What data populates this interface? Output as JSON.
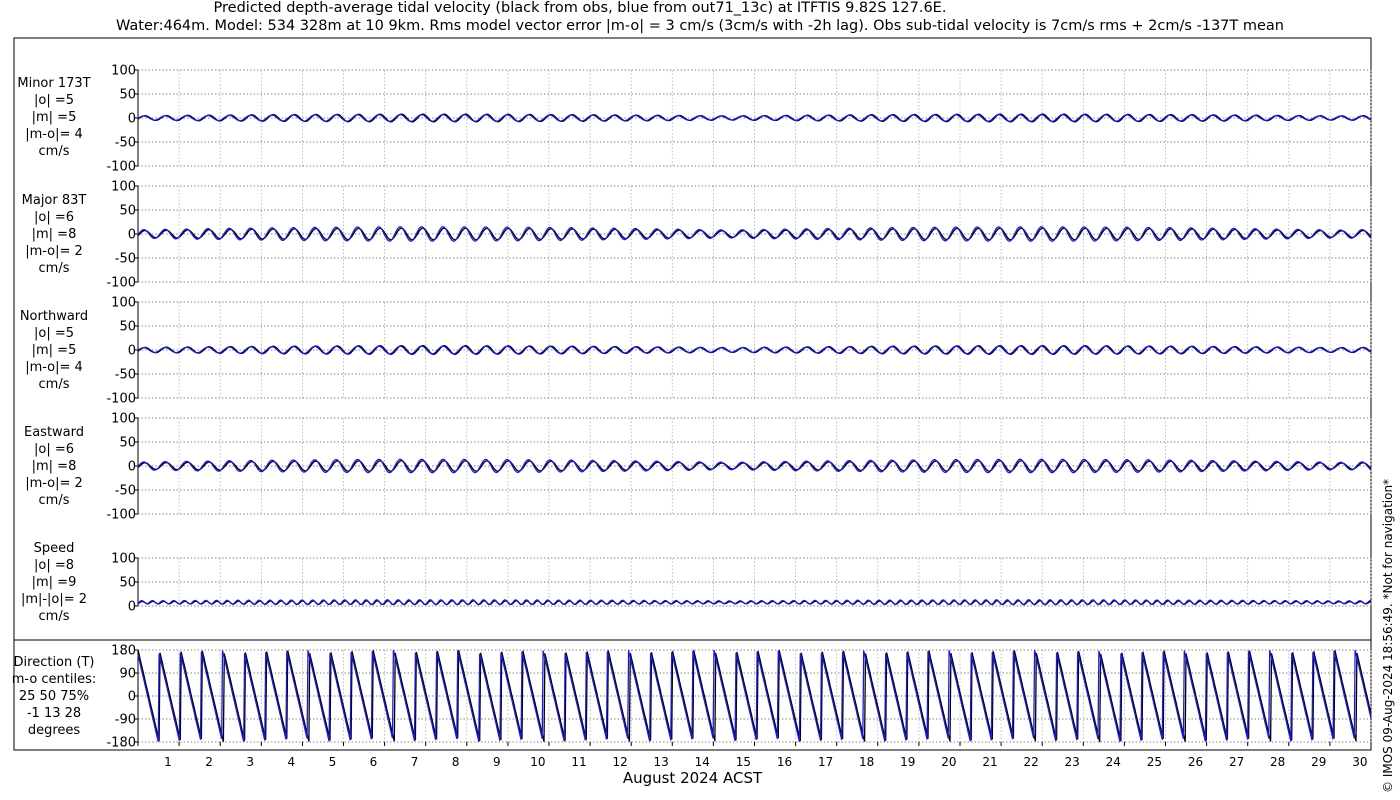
{
  "title_line1": "Predicted depth-average tidal velocity (black from obs, blue from out71_13c) at ITFTIS 9.82S 127.6E.",
  "title_line2": "Water:464m. Model: 534 328m at 10 9km. Rms model vector error |m-o| = 3 cm/s (3cm/s with -2h lag). Obs sub-tidal velocity is 7cm/s rms + 2cm/s -137T mean",
  "credit": "© IMOS 09-Aug-2024 18:56:49. *Not for navigation*",
  "x_axis_title": "August 2024 ACST",
  "colors": {
    "obs": "#000000",
    "model": "#1a1adf",
    "grid": "#b0b0b0"
  },
  "chart_data": [
    {
      "type": "line",
      "panel": "minor",
      "label_lines": [
        "Minor 173T",
        "|o| =5",
        "|m| =5",
        "|m-o|= 4",
        "cm/s"
      ],
      "ylim": [
        -100,
        100
      ],
      "yticks": [
        100,
        50,
        0,
        -50,
        -100
      ],
      "xlim": [
        1,
        31
      ],
      "xtick_labels": [
        "1",
        "2",
        "3",
        "4",
        "5",
        "6",
        "7",
        "8",
        "9",
        "10",
        "11",
        "12",
        "13",
        "14",
        "15",
        "16",
        "17",
        "18",
        "19",
        "20",
        "21",
        "22",
        "23",
        "24",
        "25",
        "26",
        "27",
        "28",
        "29",
        "30"
      ],
      "series": [
        {
          "name": "obs",
          "amplitude": 8,
          "mean": 0,
          "period_days": 0.52
        },
        {
          "name": "model",
          "amplitude": 7,
          "mean": 0,
          "period_days": 0.52
        }
      ]
    },
    {
      "type": "line",
      "panel": "major",
      "label_lines": [
        "Major 83T",
        "|o| =6",
        "|m| =8",
        "|m-o|= 2",
        "cm/s"
      ],
      "ylim": [
        -100,
        100
      ],
      "yticks": [
        100,
        50,
        0,
        -50,
        -100
      ],
      "xlim": [
        1,
        31
      ],
      "series": [
        {
          "name": "obs",
          "amplitude": 12,
          "mean": 0,
          "period_days": 0.52
        },
        {
          "name": "model",
          "amplitude": 15,
          "mean": 0,
          "period_days": 0.52
        }
      ]
    },
    {
      "type": "line",
      "panel": "northward",
      "label_lines": [
        "Northward",
        "|o| =5",
        "|m| =5",
        "|m-o|= 4",
        "cm/s"
      ],
      "ylim": [
        -100,
        100
      ],
      "yticks": [
        100,
        50,
        0,
        -50,
        -100
      ],
      "xlim": [
        1,
        31
      ],
      "series": [
        {
          "name": "obs",
          "amplitude": 9,
          "mean": 0,
          "period_days": 0.52
        },
        {
          "name": "model",
          "amplitude": 8,
          "mean": 0,
          "period_days": 0.52
        }
      ]
    },
    {
      "type": "line",
      "panel": "eastward",
      "label_lines": [
        "Eastward",
        "|o| =6",
        "|m| =8",
        "|m-o|= 2",
        "cm/s"
      ],
      "ylim": [
        -100,
        100
      ],
      "yticks": [
        100,
        50,
        0,
        -50,
        -100
      ],
      "xlim": [
        1,
        31
      ],
      "series": [
        {
          "name": "obs",
          "amplitude": 11,
          "mean": 0,
          "period_days": 0.52
        },
        {
          "name": "model",
          "amplitude": 14,
          "mean": 0,
          "period_days": 0.52
        }
      ]
    },
    {
      "type": "line",
      "panel": "speed",
      "label_lines": [
        "Speed",
        "|o| =8",
        "|m| =9",
        "|m|-|o|= 2",
        "cm/s"
      ],
      "ylim": [
        0,
        100
      ],
      "yticks": [
        100,
        50,
        0
      ],
      "xlim": [
        1,
        31
      ],
      "series": [
        {
          "name": "obs",
          "amplitude": 4,
          "mean": 7,
          "period_days": 0.26
        },
        {
          "name": "model",
          "amplitude": 5,
          "mean": 8,
          "period_days": 0.26
        }
      ]
    },
    {
      "type": "line",
      "panel": "direction",
      "label_lines": [
        "Direction (T)",
        "m-o centiles:",
        "25  50  75%",
        "-1  13  28",
        "degrees"
      ],
      "ylim": [
        -180,
        180
      ],
      "yticks": [
        180,
        90,
        0,
        -90,
        -180
      ],
      "xlim": [
        1,
        31
      ],
      "series": [
        {
          "name": "obs",
          "mean": 0,
          "period_days": 0.52
        },
        {
          "name": "model",
          "mean": 0,
          "period_days": 0.52
        }
      ]
    }
  ]
}
